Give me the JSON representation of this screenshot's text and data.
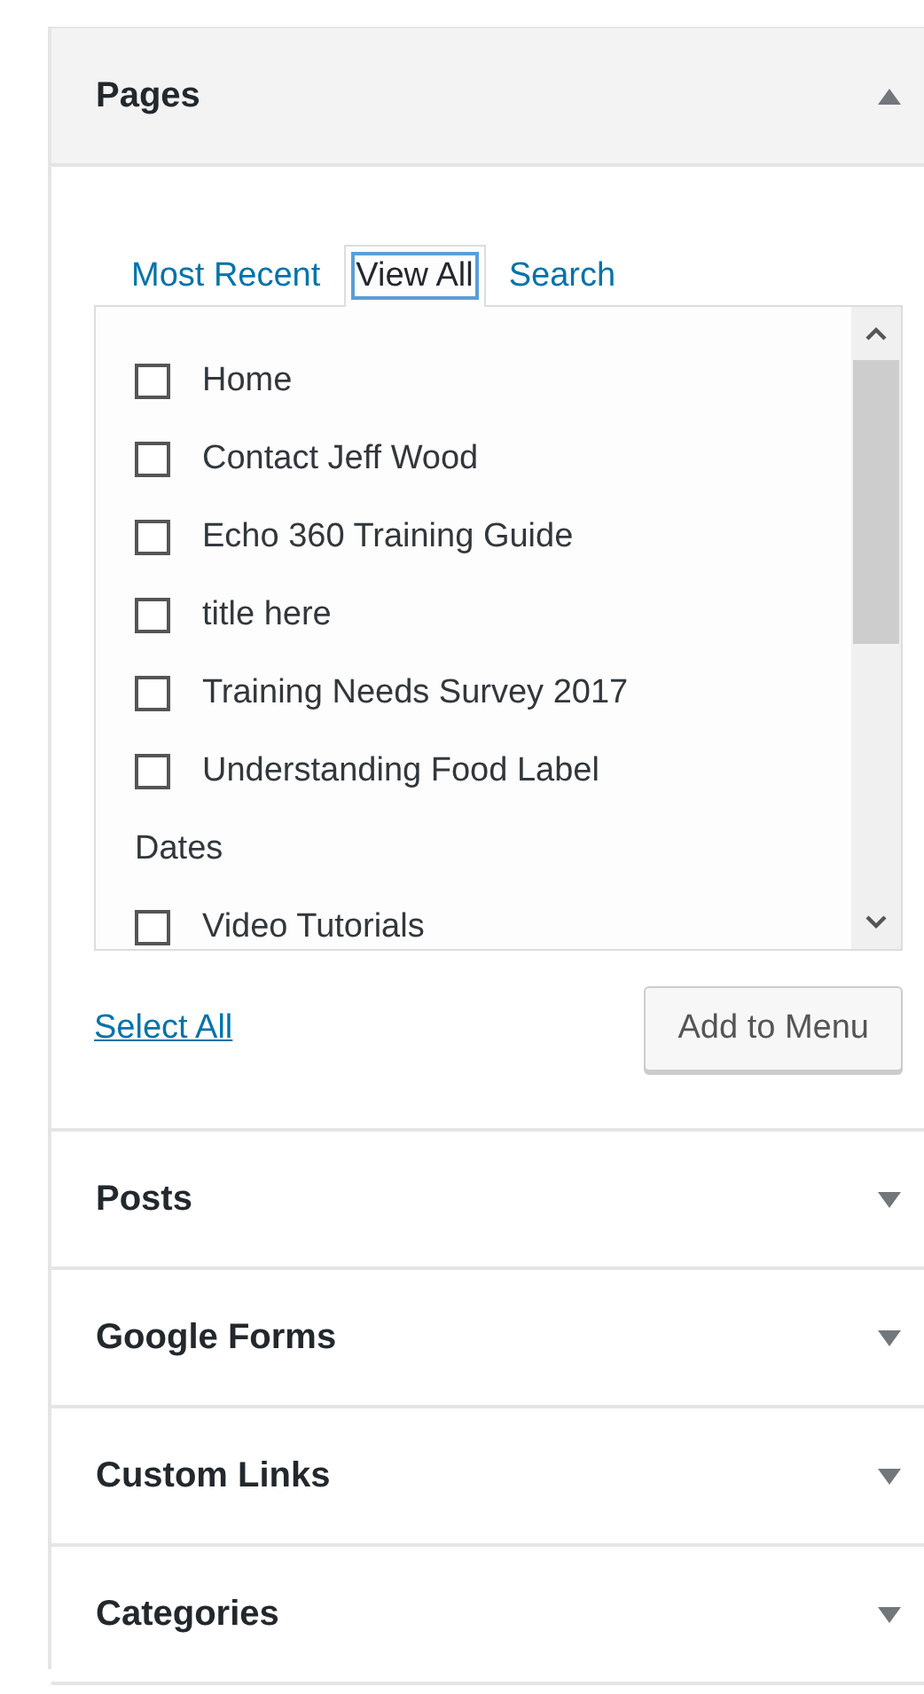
{
  "sections": [
    {
      "title": "Pages",
      "expanded": true,
      "tabs": [
        {
          "label": "Most Recent",
          "selected": false
        },
        {
          "label": "View All",
          "selected": true
        },
        {
          "label": "Search",
          "selected": false
        }
      ],
      "items": [
        {
          "kind": "page",
          "label": "Home",
          "checked": false
        },
        {
          "kind": "page",
          "label": "Contact Jeff Wood",
          "checked": false
        },
        {
          "kind": "page",
          "label": "Echo 360 Training Guide",
          "checked": false
        },
        {
          "kind": "page",
          "label": "title here",
          "checked": false
        },
        {
          "kind": "page",
          "label": "Training Needs Survey 2017",
          "checked": false
        },
        {
          "kind": "page",
          "label": "Understanding Food Label",
          "checked": false
        },
        {
          "kind": "text",
          "label": "Dates"
        },
        {
          "kind": "page",
          "label": "Video Tutorials",
          "checked": false
        }
      ],
      "select_all": "Select All",
      "add_button": "Add to Menu"
    },
    {
      "title": "Posts",
      "expanded": false
    },
    {
      "title": "Google Forms",
      "expanded": false
    },
    {
      "title": "Custom Links",
      "expanded": false
    },
    {
      "title": "Categories",
      "expanded": false
    }
  ]
}
